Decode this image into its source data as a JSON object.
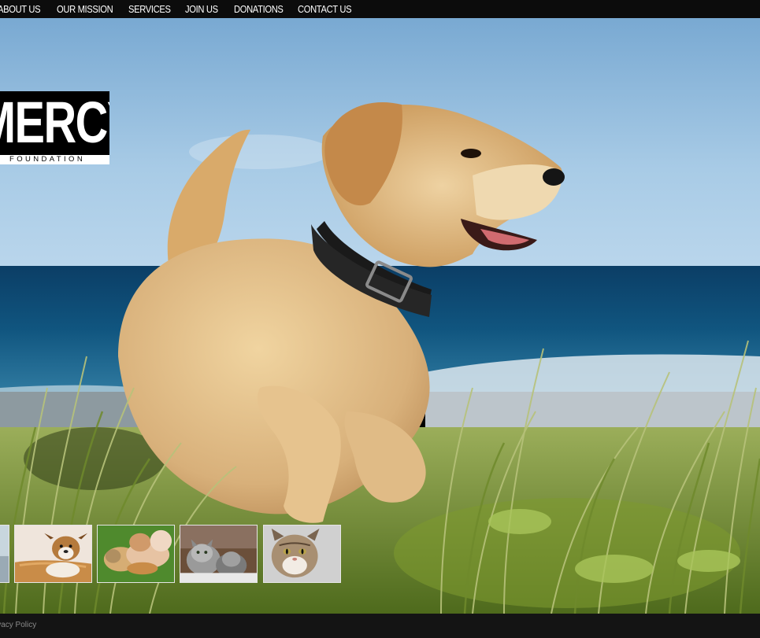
{
  "nav": {
    "items": [
      {
        "label": "ABOUT US"
      },
      {
        "label": "OUR MISSION"
      },
      {
        "label": "SERVICES"
      },
      {
        "label": "JOIN US"
      },
      {
        "label": "DONATIONS"
      },
      {
        "label": "CONTACT US"
      }
    ]
  },
  "logo": {
    "word": "MERCY",
    "sub": "FOUNDATION"
  },
  "gallery": {
    "thumbs": [
      {
        "subject": "partial-image"
      },
      {
        "subject": "puppy-in-basket"
      },
      {
        "subject": "dog-with-girl"
      },
      {
        "subject": "kittens"
      },
      {
        "subject": "tabby-cat"
      }
    ]
  },
  "footer": {
    "link": "Privacy Policy"
  },
  "colors": {
    "sky": "#9dc4e4",
    "sea": "#0e4d78",
    "grass": "#8aa04a",
    "dog": "#dcb67e",
    "bar": "#0c0c0c"
  }
}
